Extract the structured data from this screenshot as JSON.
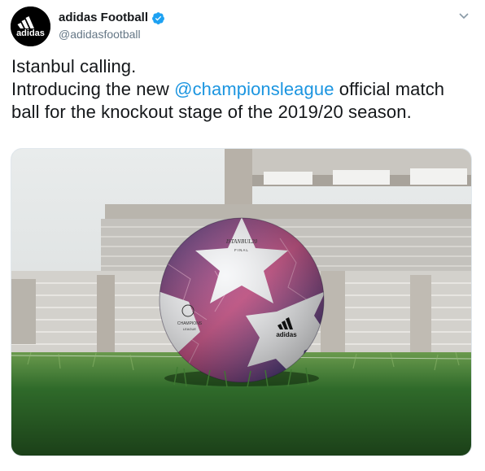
{
  "account": {
    "display_name": "adidas Football",
    "handle": "@adidasfootball",
    "avatar_text": "adidas",
    "verified": true
  },
  "tweet": {
    "line1": "Istanbul calling.",
    "line2_prefix": "Introducing the new ",
    "mention": "@championsleague",
    "line2_suffix": " official match",
    "line3": "ball for the knockout stage of the 2019/20 season."
  },
  "media": {
    "alt": "Official match ball on grass in a stadium",
    "ball_texts": {
      "final_logo": "ISTANBUL20",
      "final_sub": "FINAL",
      "champions": "CHAMPIONS",
      "league": "LEAGUE",
      "brand": "adidas"
    }
  },
  "colors": {
    "link": "#1b95e0",
    "verified_badge": "#1da1f2",
    "handle_gray": "#657786"
  },
  "icons": {
    "caret": "chevron-down-icon",
    "verified": "verified-badge-icon"
  }
}
